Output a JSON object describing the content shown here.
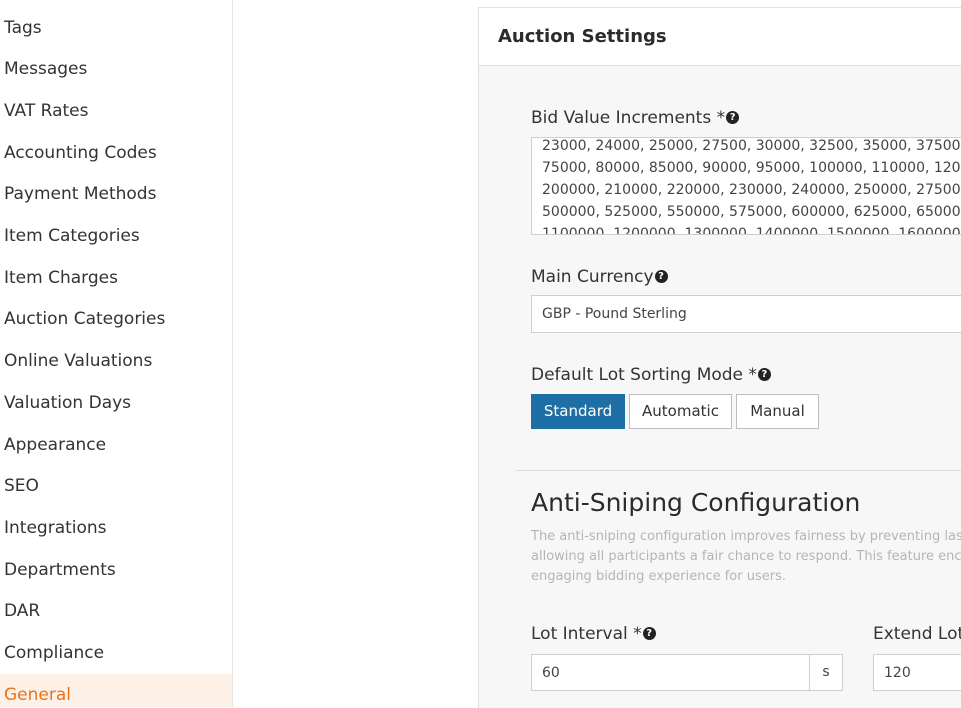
{
  "sidebar": {
    "items": [
      {
        "label": "Tags"
      },
      {
        "label": "Messages"
      },
      {
        "label": "VAT Rates"
      },
      {
        "label": "Accounting Codes"
      },
      {
        "label": "Payment Methods"
      },
      {
        "label": "Item Categories"
      },
      {
        "label": "Item Charges"
      },
      {
        "label": "Auction Categories"
      },
      {
        "label": "Online Valuations"
      },
      {
        "label": "Valuation Days"
      },
      {
        "label": "Appearance"
      },
      {
        "label": "SEO"
      },
      {
        "label": "Integrations"
      },
      {
        "label": "Departments"
      },
      {
        "label": "DAR"
      },
      {
        "label": "Compliance"
      },
      {
        "label": "General"
      }
    ],
    "active": "General",
    "active_color": "#e8741c"
  },
  "panel": {
    "title": "Auction Settings",
    "bid_increments": {
      "label": "Bid Value Increments *",
      "lines": [
        "23000, 24000, 25000, 27500, 30000, 32500, 35000, 37500",
        "75000, 80000, 85000, 90000, 95000, 100000, 110000, 120",
        "200000, 210000, 220000, 230000, 240000, 250000, 27500",
        "500000, 525000, 550000, 575000, 600000, 625000, 65000",
        "1100000, 1200000, 1300000, 1400000, 1500000, 1600000"
      ]
    },
    "main_currency": {
      "label": "Main Currency",
      "value": "GBP - Pound Sterling"
    },
    "sorting_mode": {
      "label": "Default Lot Sorting Mode *",
      "options": [
        "Standard",
        "Automatic",
        "Manual"
      ],
      "selected": "Standard",
      "accent": "#1e6fa5"
    },
    "anti_sniping": {
      "title": "Anti-Sniping Configuration",
      "description": [
        "The anti-sniping configuration improves fairness by preventing las",
        "allowing all participants a fair chance to respond. This feature enc",
        "engaging bidding experience for users."
      ],
      "lot_interval": {
        "label": "Lot Interval *",
        "value": "60",
        "unit": "s"
      },
      "extend_lot": {
        "label": "Extend Lot",
        "value": "120"
      }
    }
  },
  "icons": {
    "help": "question-circle-icon"
  }
}
